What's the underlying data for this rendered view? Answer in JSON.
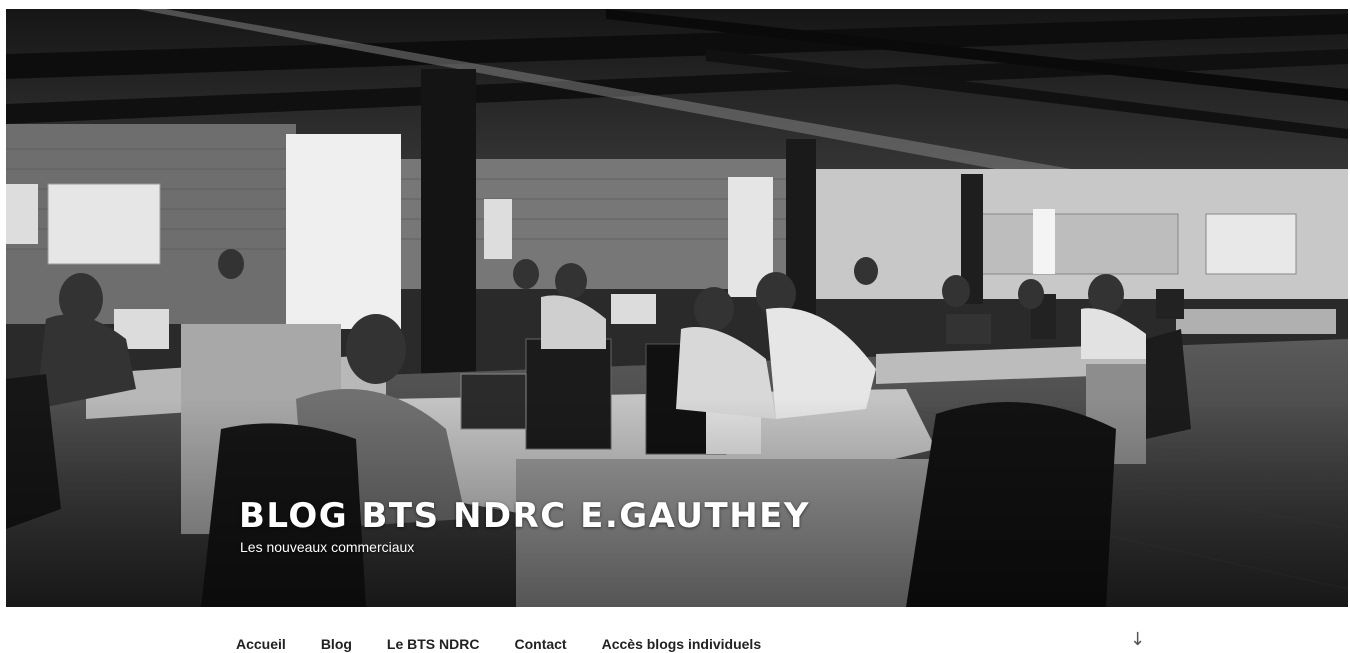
{
  "site": {
    "title": "BLOG BTS NDRC E.GAUTHEY",
    "description": "Les nouveaux commerciaux"
  },
  "nav": {
    "items": [
      {
        "label": "Accueil"
      },
      {
        "label": "Blog"
      },
      {
        "label": "Le BTS NDRC"
      },
      {
        "label": "Contact"
      },
      {
        "label": "Accès blogs individuels"
      }
    ],
    "scroll_icon": "arrow-down-icon",
    "scroll_glyph": "↓"
  },
  "header_image": {
    "subject": "black-and-white open-plan office with people working at desks"
  },
  "colors": {
    "nav_text": "#222222",
    "title_text": "#ffffff",
    "background": "#ffffff"
  }
}
